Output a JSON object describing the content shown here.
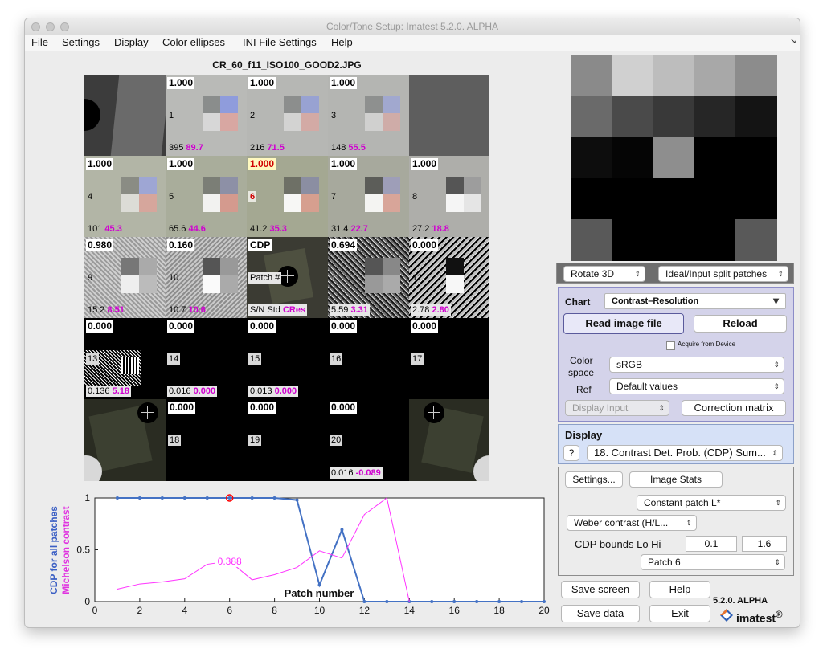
{
  "window": {
    "title": "Color/Tone Setup:  Imatest 5.2.0. ALPHA"
  },
  "menu": [
    "File",
    "Settings",
    "Display",
    "Color ellipses",
    "INI File Settings",
    "Help"
  ],
  "image_title": "CR_60_f11_ISO100_GOOD2.JPG",
  "patches": {
    "c1": {
      "top": "1.000",
      "num": "1",
      "s": "395",
      "c": "89.7"
    },
    "c2": {
      "top": "1.000",
      "num": "2",
      "s": "216",
      "c": "71.5"
    },
    "c3": {
      "top": "1.000",
      "num": "3",
      "s": "148",
      "c": "55.5"
    },
    "c4": {
      "top": "1.000",
      "num": "4",
      "s": "101",
      "c": "45.3"
    },
    "c5": {
      "top": "1.000",
      "num": "5",
      "s": "65.6",
      "c": "44.6"
    },
    "c6": {
      "top": "1.000",
      "num": "6",
      "s": "41.2",
      "c": "35.3"
    },
    "c7": {
      "top": "1.000",
      "num": "7",
      "s": "31.4",
      "c": "22.7"
    },
    "c8": {
      "top": "1.000",
      "num": "8",
      "s": "27.2",
      "c": "18.8"
    },
    "c9": {
      "top": "0.980",
      "num": "9",
      "s": "15.2",
      "c": "8.51"
    },
    "c10": {
      "top": "0.160",
      "num": "10",
      "s": "10.7",
      "c": "10.6"
    },
    "c11": {
      "top": "0.694",
      "num": "11",
      "s": "5.59",
      "c": "3.31"
    },
    "c12": {
      "top": "0.000",
      "num": "12",
      "s": "2.78",
      "c": "2.80"
    },
    "c13": {
      "top": "0.000",
      "num": "13",
      "s": "0.136",
      "c": "5.18"
    },
    "c14": {
      "top": "0.000",
      "num": "14",
      "s": "0.016",
      "c": "0.000"
    },
    "c15": {
      "top": "0.000",
      "num": "15",
      "s": "0.013",
      "c": "0.000"
    },
    "c16": {
      "top": "0.000",
      "num": "16"
    },
    "c17": {
      "top": "0.000",
      "num": "17"
    },
    "c18": {
      "top": "0.000",
      "num": "18"
    },
    "c19": {
      "top": "0.000",
      "num": "19"
    },
    "c20": {
      "top": "0.000",
      "num": "20",
      "s": "0.016",
      "c": "-0.089"
    }
  },
  "legend_cell": {
    "title": "CDP",
    "mid": "Patch #",
    "bot_plain": "S/N Std",
    "bot_magenta": "CRes"
  },
  "controls": {
    "rotate": "Rotate 3D",
    "split": "Ideal/Input split patches",
    "chart_label": "Chart",
    "chart_value": "Contrast–Resolution",
    "read_image": "Read image file",
    "reload": "Reload",
    "acquire": "Acquire from Device",
    "colorspace_label_1": "Color",
    "colorspace_label_2": "space",
    "colorspace": "sRGB",
    "ref_label": "Ref",
    "ref": "Default values",
    "display_input": "Display Input",
    "correction": "Correction matrix",
    "display_label": "Display",
    "help_q": "?",
    "display_value": "18. Contrast Det. Prob. (CDP) Sum...",
    "settings": "Settings...",
    "image_stats": "Image Stats",
    "constant_patch": "Constant patch L*",
    "weber": "Weber contrast (H/L...",
    "cdp_bounds_label": "CDP bounds Lo Hi",
    "cdp_lo": "0.1",
    "cdp_hi": "1.6",
    "patch_select": "Patch  6",
    "save_screen": "Save screen",
    "help": "Help",
    "save_data": "Save data",
    "exit": "Exit",
    "version": "5.2.0. ALPHA",
    "logo_text": "imatest",
    "logo_mark": "®"
  },
  "colors": {
    "cdp": "#4472c4",
    "michelson": "#ff33ff",
    "highlight": "#ff0000"
  },
  "chart_data": {
    "type": "line",
    "xlabel": "Patch number",
    "ylabel_1": "CDP for all patches",
    "ylabel_2": "Michelson contrast",
    "xlim": [
      0,
      20
    ],
    "ylim": [
      0,
      1
    ],
    "xticks": [
      "0",
      "2",
      "4",
      "6",
      "8",
      "10",
      "12",
      "14",
      "16",
      "18",
      "20"
    ],
    "yticks": [
      "0",
      "0.5",
      "1"
    ],
    "series": [
      {
        "x": [
          1,
          2,
          3,
          4,
          5,
          6,
          7,
          8,
          9,
          10,
          11,
          12,
          13,
          14,
          15,
          16,
          17,
          18,
          19,
          20
        ],
        "values": [
          1,
          1,
          1,
          1,
          1,
          1,
          1,
          1,
          0.98,
          0.16,
          0.694,
          0,
          0,
          0,
          0,
          0,
          0,
          0,
          0,
          0
        ]
      },
      {
        "x": [
          1,
          2,
          3,
          4,
          5,
          6,
          7,
          8,
          9,
          10,
          11,
          12,
          13,
          14
        ],
        "values": [
          0.12,
          0.17,
          0.19,
          0.22,
          0.36,
          0.39,
          0.21,
          0.26,
          0.33,
          0.49,
          0.42,
          0.84,
          1.0,
          0
        ]
      }
    ],
    "annotation": {
      "x": 6,
      "y": 0.388,
      "text": "0.388"
    }
  }
}
